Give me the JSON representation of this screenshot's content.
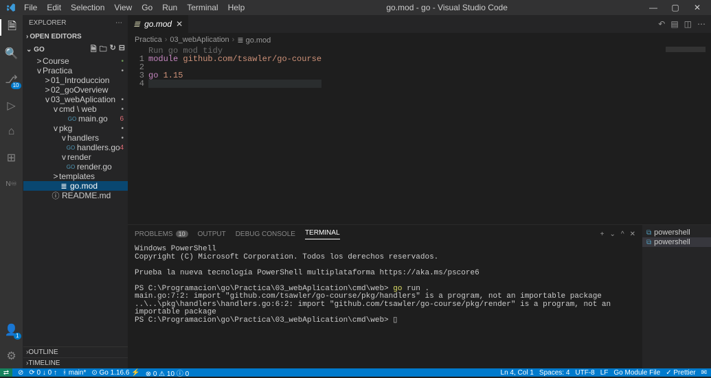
{
  "titlebar": {
    "menu": [
      "File",
      "Edit",
      "Selection",
      "View",
      "Go",
      "Run",
      "Terminal",
      "Help"
    ],
    "title": "go.mod - go - Visual Studio Code"
  },
  "activity": {
    "badges": {
      "sourcecontrol": "10",
      "account": "1"
    }
  },
  "sidebar": {
    "title": "EXPLORER",
    "open_editors": "OPEN EDITORS",
    "root": "GO",
    "tree": [
      {
        "ind": 1,
        "chev": ">",
        "ico": "",
        "name": "Course",
        "dot": "•",
        "col": "#6a9955",
        "sel": false
      },
      {
        "ind": 1,
        "chev": "v",
        "ico": "",
        "name": "Practica",
        "dot": "•",
        "col": "#aaa",
        "sel": false
      },
      {
        "ind": 2,
        "chev": ">",
        "ico": "",
        "name": "01_Introduccion",
        "dot": "",
        "sel": false
      },
      {
        "ind": 2,
        "chev": ">",
        "ico": "",
        "name": "02_goOverview",
        "dot": "",
        "sel": false
      },
      {
        "ind": 2,
        "chev": "v",
        "ico": "",
        "name": "03_webAplication",
        "dot": "•",
        "col": "#aaa",
        "sel": false
      },
      {
        "ind": 3,
        "chev": "v",
        "ico": "",
        "name": "cmd \\ web",
        "dot": "•",
        "col": "#aaa",
        "sel": false
      },
      {
        "ind": 4,
        "chev": "",
        "ico": "GO",
        "name": "main.go",
        "dot": "6",
        "col": "#e06c75",
        "sel": false,
        "num": true
      },
      {
        "ind": 3,
        "chev": "v",
        "ico": "",
        "name": "pkg",
        "dot": "•",
        "col": "#aaa",
        "sel": false
      },
      {
        "ind": 4,
        "chev": "v",
        "ico": "",
        "name": "handlers",
        "dot": "•",
        "col": "#aaa",
        "sel": false
      },
      {
        "ind": 4,
        "chev": "",
        "ico": "GO",
        "name": "handlers.go",
        "dot": "4",
        "col": "#e06c75",
        "sel": false,
        "num": true,
        "extraInd": 10
      },
      {
        "ind": 4,
        "chev": "v",
        "ico": "",
        "name": "render",
        "dot": "",
        "sel": false
      },
      {
        "ind": 4,
        "chev": "",
        "ico": "GO",
        "name": "render.go",
        "dot": "",
        "sel": false,
        "extraInd": 10
      },
      {
        "ind": 3,
        "chev": ">",
        "ico": "",
        "name": "templates",
        "dot": "",
        "sel": false
      },
      {
        "ind": 3,
        "chev": "",
        "ico": "≣",
        "name": "go.mod",
        "dot": "",
        "sel": true
      },
      {
        "ind": 2,
        "chev": "",
        "ico": "ⓘ",
        "name": "README.md",
        "dot": "",
        "sel": false
      }
    ],
    "outline": "OUTLINE",
    "timeline": "TIMELINE"
  },
  "editor": {
    "tab": {
      "name": "go.mod"
    },
    "breadcrumb": [
      "Practica",
      "03_webAplication",
      "go.mod"
    ],
    "hint": "Run go mod tidy",
    "lines": [
      {
        "n": 1,
        "html": "<span class='kw'>module</span> <span class='str'>github.com/tsawler/go-course</span>"
      },
      {
        "n": 2,
        "html": ""
      },
      {
        "n": 3,
        "html": "<span class='kw'>go</span> <span class='str'>1.15</span>"
      },
      {
        "n": 4,
        "html": "",
        "current": true
      }
    ]
  },
  "panel": {
    "tabs": {
      "problems": "PROBLEMS",
      "problems_badge": "10",
      "output": "OUTPUT",
      "debug": "DEBUG CONSOLE",
      "terminal": "TERMINAL"
    },
    "terminal_lines": [
      "Windows PowerShell",
      "Copyright (C) Microsoft Corporation. Todos los derechos reservados.",
      "",
      "Prueba la nueva tecnología PowerShell multiplataforma https://aka.ms/pscore6",
      "",
      "PS C:\\Programacion\\go\\Practica\\03_webAplication\\cmd\\web> <span class='cmd'>go</span> run .",
      "main.go:7:2: import \"github.com/tsawler/go-course/pkg/handlers\" is a program, not an importable package",
      "..\\..\\pkg\\handlers\\handlers.go:6:2: import \"github.com/tsawler/go-course/pkg/render\" is a program, not an importable package",
      "PS C:\\Programacion\\go\\Practica\\03_webAplication\\cmd\\web> ▯"
    ],
    "terminals": [
      {
        "name": "powershell",
        "sel": false
      },
      {
        "name": "powershell",
        "sel": true
      }
    ]
  },
  "status": {
    "left": [
      "⊘",
      "⟳ 0 ↓ 0 ↑",
      "ᚼ main*",
      "⊙ Go 1.16.6 ⚡",
      "⊗ 0 ⚠ 10 ⓘ 0"
    ],
    "right": [
      "Ln 4, Col 1",
      "Spaces: 4",
      "UTF-8",
      "LF",
      "Go Module File",
      "✓ Prettier",
      "✉"
    ]
  }
}
